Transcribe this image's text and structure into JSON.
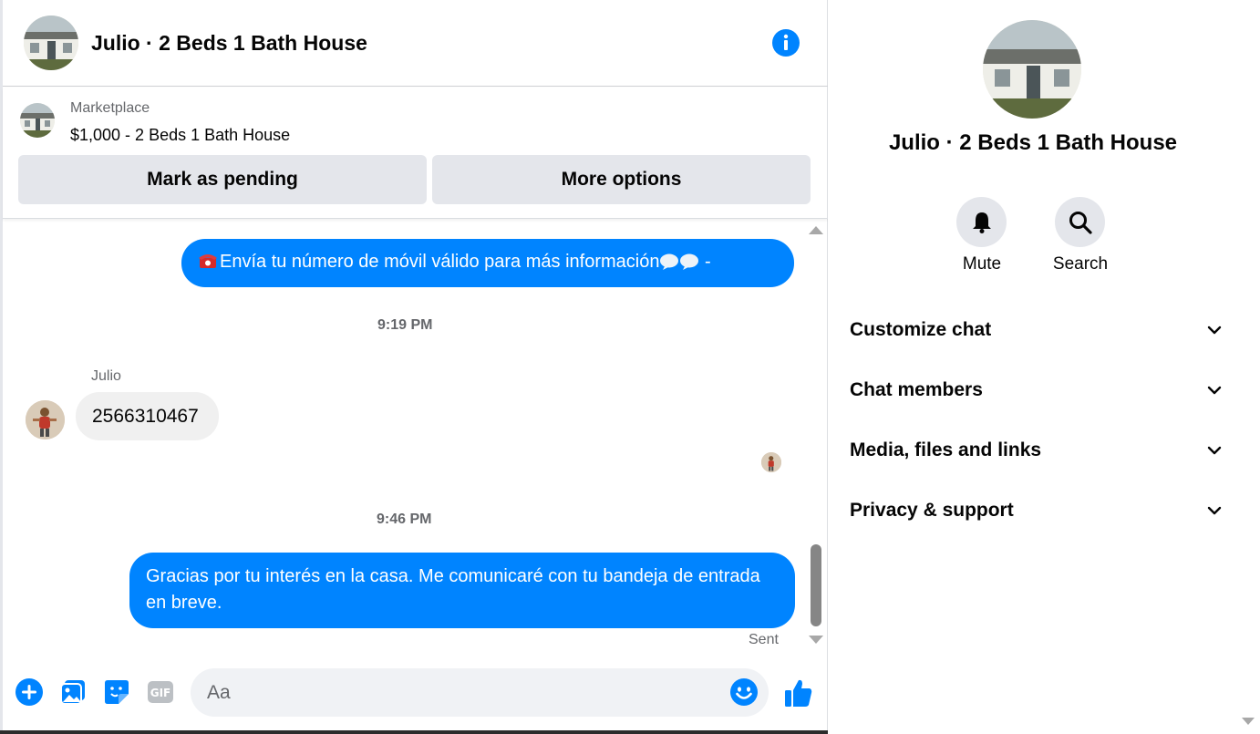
{
  "chat": {
    "title": "Julio · 2 Beds 1 Bath House",
    "listing": {
      "type": "Marketplace",
      "price_title": "$1,000 - 2 Beds 1 Bath House",
      "pending_label": "Mark as pending",
      "more_label": "More options"
    },
    "messages": [
      {
        "direction": "outgoing",
        "text": "Envía tu número de móvil válido para más información",
        "suffix": " -"
      },
      {
        "type": "timestamp",
        "text": "9:19 PM"
      },
      {
        "direction": "incoming",
        "sender": "Julio",
        "text": "2566310467"
      },
      {
        "type": "timestamp",
        "text": "9:46 PM"
      },
      {
        "direction": "outgoing",
        "text": "Gracias por tu interés en la casa. Me comunicaré con tu bandeja de entrada en breve.",
        "status": "Sent"
      }
    ],
    "composer": {
      "placeholder": "Aa",
      "icons": [
        "plus-circle-icon",
        "image-icon",
        "sticker-icon",
        "gif-icon",
        "emoji-icon",
        "thumbs-up-icon"
      ]
    }
  },
  "info_panel": {
    "title": "Julio · 2 Beds 1 Bath House",
    "actions": [
      {
        "label": "Mute",
        "icon": "bell-icon"
      },
      {
        "label": "Search",
        "icon": "search-icon"
      }
    ],
    "sections": [
      "Customize chat",
      "Chat members",
      "Media, files and links",
      "Privacy & support"
    ]
  },
  "colors": {
    "accent": "#0084ff",
    "incoming_bubble": "#f0f0f0",
    "button_bg": "#e4e6eb",
    "secondary_text": "#65676b"
  }
}
